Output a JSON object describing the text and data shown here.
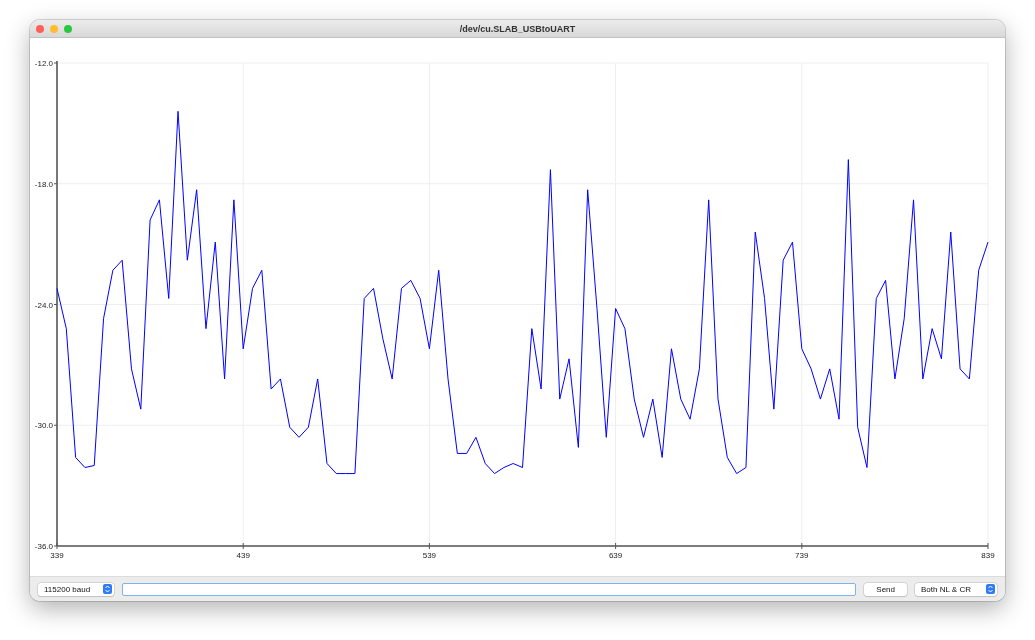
{
  "window": {
    "title": "/dev/cu.SLAB_USBtoUART"
  },
  "plot": {
    "chart_data": {
      "type": "line",
      "x": [
        339,
        344,
        349,
        354,
        359,
        364,
        369,
        374,
        379,
        384,
        389,
        394,
        399,
        404,
        409,
        414,
        419,
        424,
        429,
        434,
        439,
        444,
        449,
        454,
        459,
        464,
        469,
        474,
        479,
        484,
        489,
        494,
        499,
        504,
        509,
        514,
        519,
        524,
        529,
        534,
        539,
        544,
        549,
        554,
        559,
        564,
        569,
        574,
        579,
        584,
        589,
        594,
        599,
        604,
        609,
        614,
        619,
        624,
        629,
        634,
        639,
        644,
        649,
        654,
        659,
        664,
        669,
        674,
        679,
        684,
        689,
        694,
        699,
        704,
        709,
        714,
        719,
        724,
        729,
        734,
        739,
        744,
        749,
        754,
        759,
        764,
        769,
        774,
        779,
        784,
        789,
        794,
        799,
        804,
        809,
        814,
        819,
        824,
        829,
        834,
        839
      ],
      "series": [
        {
          "color": "#0000ff",
          "values": [
            -23.2,
            -25.2,
            -31.6,
            -32.1,
            -32.0,
            -24.7,
            -22.3,
            -21.8,
            -27.2,
            -29.2,
            -19.8,
            -18.8,
            -23.7,
            -14.4,
            -21.8,
            -18.3,
            -25.2,
            -20.9,
            -27.7,
            -18.8,
            -26.2,
            -23.2,
            -22.3,
            -28.2,
            -27.7,
            -30.1,
            -30.6,
            -30.1,
            -27.7,
            -31.9,
            -32.4,
            -32.4,
            -32.4,
            -23.7,
            -23.2,
            -25.7,
            -27.7,
            -23.2,
            -22.8,
            -23.7,
            -26.2,
            -22.3,
            -27.7,
            -31.4,
            -31.4,
            -30.6,
            -31.9,
            -32.4,
            -32.1,
            -31.9,
            -32.1,
            -25.2,
            -28.2,
            -17.3,
            -28.7,
            -26.7,
            -31.1,
            -18.3,
            -24.2,
            -30.6,
            -24.2,
            -25.2,
            -28.7,
            -30.6,
            -28.7,
            -31.6,
            -26.2,
            -28.7,
            -29.7,
            -27.2,
            -18.8,
            -28.7,
            -31.6,
            -32.4,
            -32.1,
            -20.4,
            -23.7,
            -29.2,
            -21.8,
            -20.9,
            -26.2,
            -27.2,
            -28.7,
            -27.2,
            -29.7,
            -16.8,
            -30.1,
            -32.1,
            -23.7,
            -22.8,
            -27.7,
            -24.7,
            -18.8,
            -27.7,
            -25.2,
            -26.7,
            -20.4,
            -27.2,
            -27.7,
            -22.3,
            -20.9
          ]
        }
      ],
      "grid": true,
      "xlim": [
        339,
        839
      ],
      "ylim": [
        -36,
        -12
      ],
      "xticks": [
        339,
        439,
        539,
        639,
        739,
        839
      ],
      "yticks": [
        {
          "value": -12,
          "label": "-12.0"
        },
        {
          "value": -18,
          "label": "-18.0"
        },
        {
          "value": -24,
          "label": "-24.0"
        },
        {
          "value": -30,
          "label": "-30.0"
        },
        {
          "value": -36,
          "label": "-36.0"
        }
      ]
    }
  },
  "toolbar": {
    "baud_rate": "115200 baud",
    "send_button": "Send",
    "line_ending": "Both NL & CR"
  }
}
